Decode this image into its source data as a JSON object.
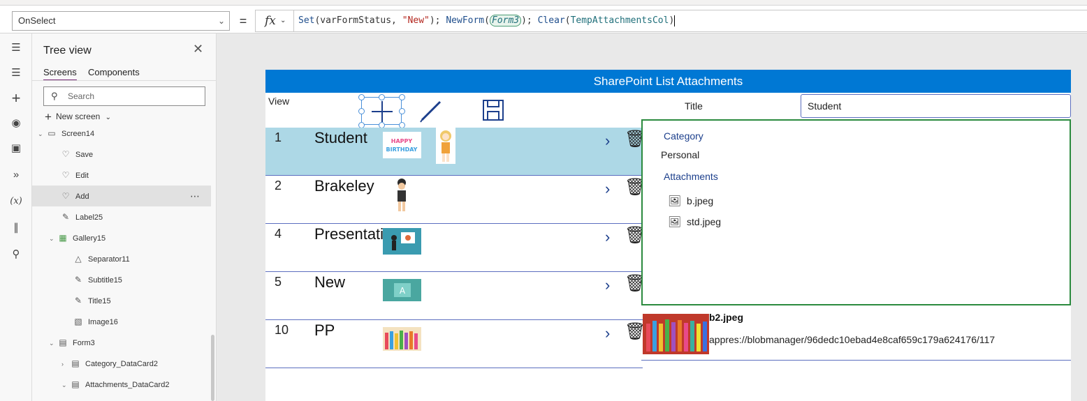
{
  "formula_bar": {
    "property": "OnSelect",
    "fx": "fx",
    "equals": "=",
    "formula": {
      "t1": "Set",
      "t2": "(varFormStatus, ",
      "t3": "\"New\"",
      "t4": "); ",
      "t5": "NewForm",
      "t6": "(",
      "t7": "Form3",
      "t8": "); ",
      "t9": "Clear",
      "t10": "(",
      "t11": "TempAttachmentsCol",
      "t12": ")"
    }
  },
  "tree": {
    "title": "Tree view",
    "tabs": [
      "Screens",
      "Components"
    ],
    "search_placeholder": "Search",
    "new_screen": "New screen",
    "nodes": [
      {
        "label": "Screen14"
      },
      {
        "label": "Save"
      },
      {
        "label": "Edit"
      },
      {
        "label": "Add"
      },
      {
        "label": "Label25"
      },
      {
        "label": "Gallery15"
      },
      {
        "label": "Separator11"
      },
      {
        "label": "Subtitle15"
      },
      {
        "label": "Title15"
      },
      {
        "label": "Image16"
      },
      {
        "label": "Form3"
      },
      {
        "label": "Category_DataCard2"
      },
      {
        "label": "Attachments_DataCard2"
      }
    ]
  },
  "app": {
    "header": "SharePoint  List  Attachments",
    "view_label": "View",
    "title_label": "Title",
    "title_value": "Student",
    "gallery": [
      {
        "num": "1",
        "title": "Student"
      },
      {
        "num": "2",
        "title": "Brakeley"
      },
      {
        "num": "4",
        "title": "Presentati"
      },
      {
        "num": "5",
        "title": "New"
      },
      {
        "num": "10",
        "title": "PP"
      }
    ],
    "form": {
      "category_label": "Category",
      "category_value": "Personal",
      "attachments_label": "Attachments",
      "attachments": [
        "b.jpeg",
        "std.jpeg"
      ]
    },
    "detail": {
      "name": "b2.jpeg",
      "url": "appres://blobmanager/96dedc10ebad4e8caf659c179a624176/117"
    }
  },
  "colors": {
    "header": "#0078d4",
    "selected_row": "#add8e6",
    "form_border": "#2b8a3e",
    "accent": "#742774"
  }
}
